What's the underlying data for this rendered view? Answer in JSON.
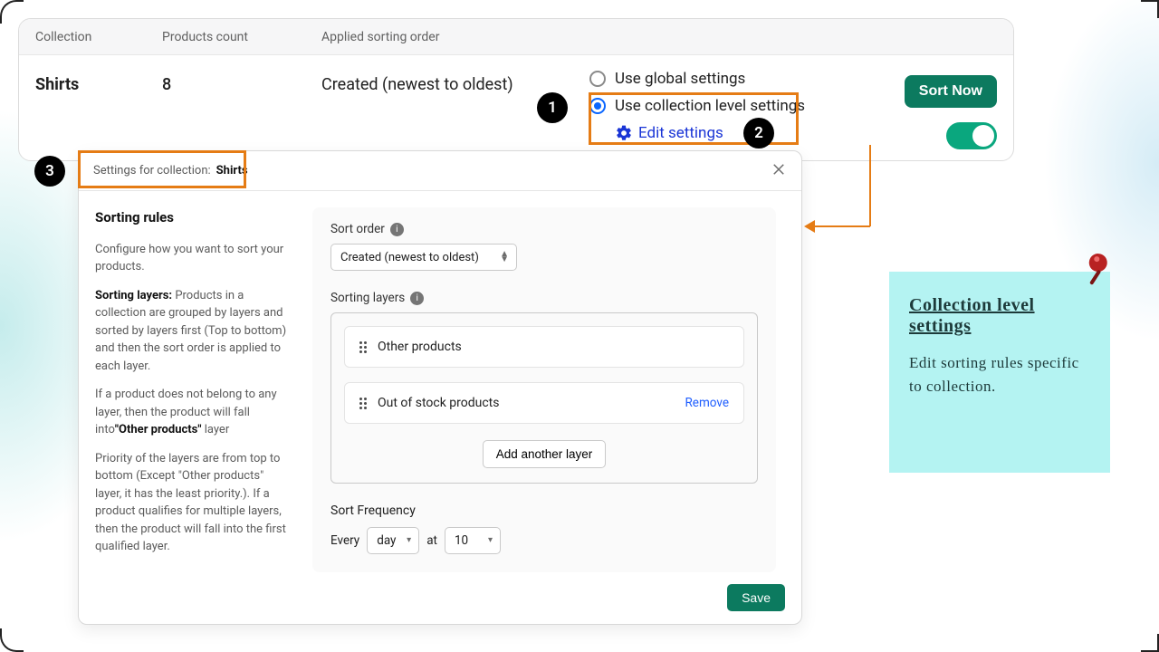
{
  "table": {
    "headers": {
      "collection": "Collection",
      "count": "Products count",
      "sorting": "Applied sorting order"
    },
    "row": {
      "collection": "Shirts",
      "count": "8",
      "sorting": "Created (newest to oldest)",
      "option_global": "Use global settings",
      "option_collection": "Use collection level settings",
      "edit_settings": "Edit settings",
      "sort_now": "Sort Now"
    }
  },
  "modal": {
    "title_prefix": "Settings for collection:",
    "title_collection": "Shirts",
    "side": {
      "heading": "Sorting rules",
      "p1": "Configure how you want to sort your products.",
      "p2a_label": "Sorting layers:",
      "p2a": "Products in a collection are grouped by layers and sorted by layers first (Top to bottom) and then the sort order is applied to each layer.",
      "p3a": "If a product does not belong to any layer, then the product will fall into",
      "p3b": "\"Other products\"",
      "p3c": " layer",
      "p4": "Priority of the layers are from top to bottom (Except \"Other products\" layer, it has the least priority.). If a product qualifies for multiple layers, then the product will fall into the first qualified layer."
    },
    "form": {
      "sort_order_label": "Sort order",
      "sort_order_value": "Created (newest to oldest)",
      "sorting_layers_label": "Sorting layers",
      "layers": [
        "Other products",
        "Out of stock products"
      ],
      "remove_label": "Remove",
      "add_layer": "Add another layer",
      "freq_label": "Sort Frequency",
      "freq_every": "Every",
      "freq_unit": "day",
      "freq_at": "at",
      "freq_time": "10",
      "save": "Save"
    }
  },
  "note": {
    "title": "Collection level settings",
    "body": "Edit sorting rules specific to collection."
  },
  "badges": {
    "b1": "1",
    "b2": "2",
    "b3": "3"
  }
}
